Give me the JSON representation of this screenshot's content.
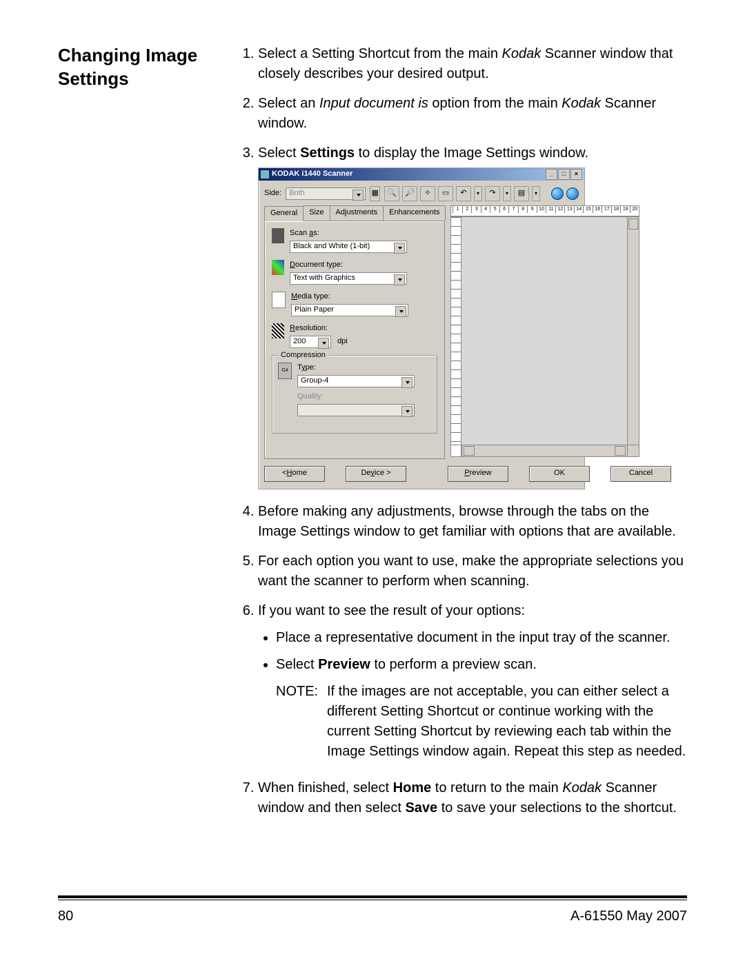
{
  "section_title": "Changing Image Settings",
  "steps": {
    "s1a": "Select a Setting Shortcut from the main ",
    "s1b": "Kodak",
    "s1c": " Scanner window that closely describes your desired output.",
    "s2a": "Select an ",
    "s2b": "Input document is",
    "s2c": " option from the main ",
    "s2d": "Kodak",
    "s2e": " Scanner window.",
    "s3a": "Select ",
    "s3b": "Settings",
    "s3c": " to display the Image Settings window.",
    "s4": "Before making any adjustments, browse through the tabs on the Image Settings window to get familiar with options that are available.",
    "s5": "For each option you want to use, make the appropriate selections you want the scanner to perform when scanning.",
    "s6": "If you want to see the result of your options:",
    "s6_b1": "Place a representative document in the input tray of the scanner.",
    "s6_b2a": "Select ",
    "s6_b2b": "Preview",
    "s6_b2c": " to perform a preview scan.",
    "s6_note_label": "NOTE:",
    "s6_note": "If the images are not acceptable, you can either select a different Setting Shortcut or continue working with the current Setting Shortcut by reviewing each tab within the Image Settings window again. Repeat this step as needed.",
    "s7a": "When finished, select ",
    "s7b": "Home",
    "s7c": " to return to the main ",
    "s7d": "Kodak",
    "s7e": " Scanner window and then select ",
    "s7f": "Save",
    "s7g": " to save your selections to the shortcut."
  },
  "window": {
    "title": "KODAK i1440 Scanner",
    "side_label": "Side:",
    "side_value": "Both",
    "tabs": [
      "General",
      "Size",
      "Adjustments",
      "Enhancements"
    ],
    "fields": {
      "scan_as_label": "Scan as:",
      "scan_as_ul": "a",
      "scan_as_value": "Black and White (1-bit)",
      "doc_type_label": "Document type:",
      "doc_type_ul": "D",
      "doc_type_value": "Text with Graphics",
      "media_type_label": "Media type:",
      "media_type_ul": "M",
      "media_type_value": "Plain Paper",
      "resolution_label": "Resolution:",
      "resolution_ul": "R",
      "resolution_value": "200",
      "resolution_unit": "dpi",
      "compression_legend": "Compression",
      "compression_ul": "C",
      "type_label": "Type:",
      "type_ul": "y",
      "type_value": "Group-4",
      "quality_label": "Quality:",
      "g4": "G4"
    },
    "ruler_ticks": [
      "1",
      "2",
      "3",
      "4",
      "5",
      "6",
      "7",
      "8",
      "9",
      "10",
      "11",
      "12",
      "13",
      "14",
      "15",
      "16",
      "17",
      "18",
      "19",
      "20"
    ],
    "buttons": {
      "home": "Home",
      "home_ul": "H",
      "device": "Device >",
      "device_ul": "v",
      "preview": "Preview",
      "preview_ul": "P",
      "ok": "OK",
      "cancel": "Cancel"
    }
  },
  "footer": {
    "page": "80",
    "docid": "A-61550  May 2007"
  }
}
